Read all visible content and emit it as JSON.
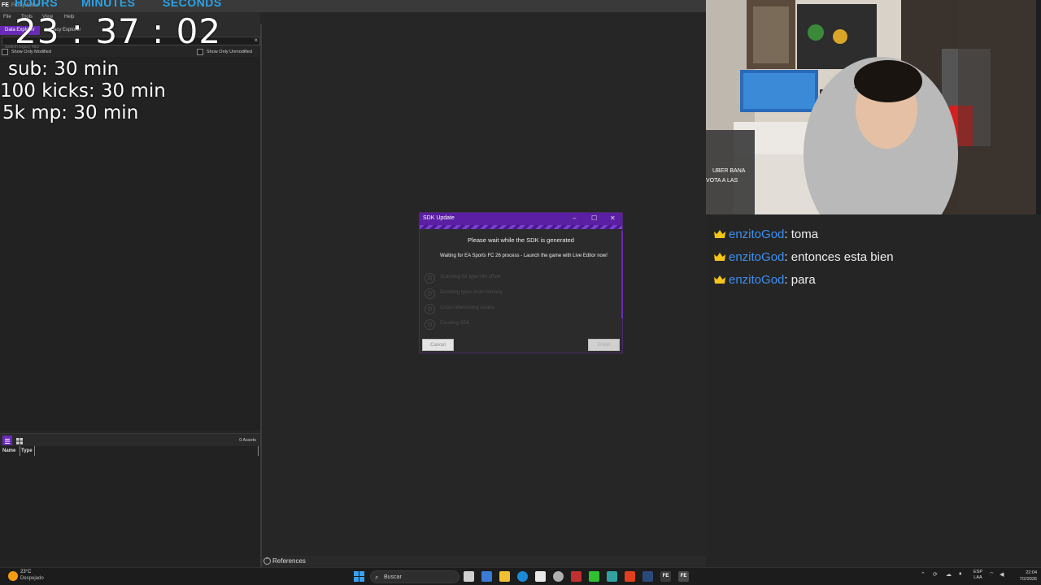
{
  "window": {
    "logo": "FE",
    "title": "Frosty Editor",
    "menu": [
      "File",
      "Tools",
      "View",
      "Help"
    ],
    "tabs": [
      "Data Explorer",
      "Legacy Explorer"
    ],
    "search_placeholder": "Search legacy files",
    "show_only_modified": "Show Only Modified",
    "show_only_unmodified": "Show Only Unmodified",
    "assets_count": "0 Assets",
    "col_name": "Name",
    "col_type": "Type",
    "references_label": "References"
  },
  "timer": {
    "hours_label": "HOURS",
    "minutes_label": "MINUTES",
    "seconds_label": "SECONDS",
    "hours": "23",
    "minutes": "37",
    "seconds": "02"
  },
  "goals": [
    "sub: 30 min",
    "100 kicks: 30 min",
    "5k mp: 30 min"
  ],
  "dialog": {
    "title": "SDK Update",
    "heading": "Please wait while the SDK is generated",
    "current_step": "Waiting for EA Sports FC 26 process - Launch the game with Live Editor now!",
    "steps": [
      "Scanning for type info offset",
      "Dumping types from memory",
      "Cross-referencing assets",
      "Creating SDK"
    ],
    "cancel_label": "Cancel",
    "finish_label": "Finish"
  },
  "chat": {
    "messages": [
      {
        "user": "enzitoGod",
        "text": ": toma"
      },
      {
        "user": "enzitoGod",
        "text": ": entonces esta bien"
      },
      {
        "user": "enzitoGod",
        "text": ": para"
      }
    ],
    "crown_color": "#f5c518",
    "user_color": "#3d8ff0"
  },
  "webcam": {
    "overlay_lines": [
      "UBER BANA",
      "VOTA A LAS"
    ]
  },
  "taskbar": {
    "temperature": "23°C",
    "weather": "Despejado",
    "search_label": "Buscar",
    "lang_top": "ESP",
    "lang_bottom": "LAA",
    "time": "22:04",
    "date": "7/2/2026"
  },
  "colors": {
    "accent_purple": "#6a2ab8",
    "timer_label_blue": "#2aa3e8"
  }
}
